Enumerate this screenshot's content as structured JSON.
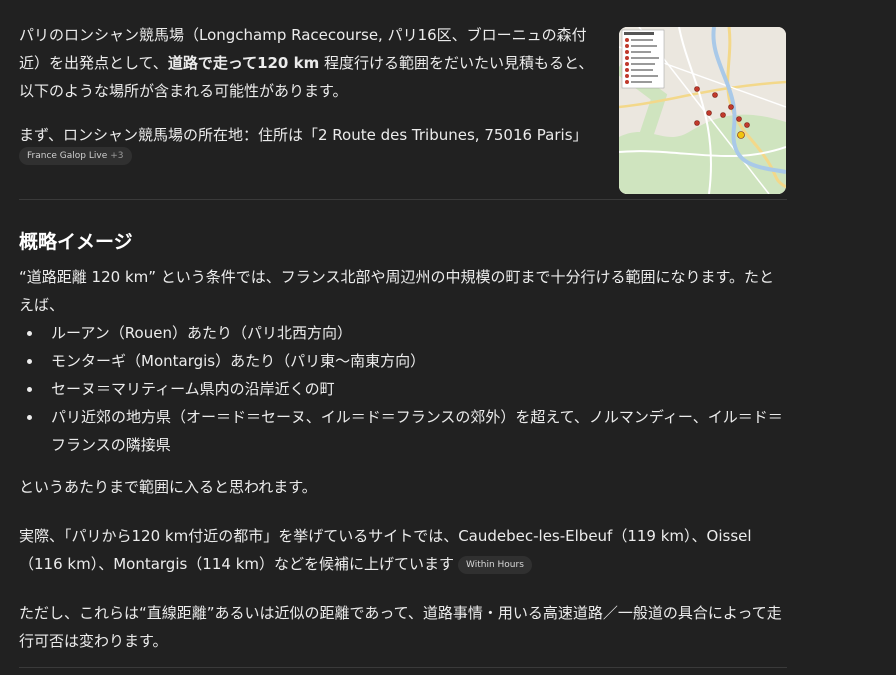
{
  "intro": {
    "p1_part1": "パリのロンシャン競馬場（Longchamp Racecourse, パリ16区、ブローニュの森付近）を出発点として、",
    "p1_bold": "道路で走って120 km",
    "p1_part2": " 程度行ける範囲をだいたい見積もると、以下のような場所が含まれる可能性があります。",
    "p2": "まず、ロンシャン競馬場の所在地：住所は「2 Route des Tribunes, 75016 Paris」",
    "citation_label": "France Galop Live",
    "citation_more": "+3"
  },
  "section": {
    "heading": "概略イメージ",
    "lead": "“道路距離 120 km” という条件では、フランス北部や周辺州の中規模の町まで十分行ける範囲になります。たとえば、",
    "bullets": [
      "ルーアン（Rouen）あたり（パリ北西方向）",
      "モンターギ（Montargis）あたり（パリ東〜南東方向）",
      "セーヌ＝マリティーム県内の沿岸近くの町",
      "パリ近郊の地方県（オー＝ド＝セーヌ、イル＝ド＝フランスの郊外）を超えて、ノルマンディー、イル＝ド＝フランスの隣接県"
    ],
    "after": "というあたりまで範囲に入ると思われます。",
    "p_sites": "実際、「パリから120 km付近の都市」を挙げているサイトでは、Caudebec-les-Elbeuf（119 km）、Oissel（116 km）、Montargis（114 km）などを候補に上げています",
    "sites_badge": "Within Hours",
    "p_note": "ただし、これらは“直線距離”あるいは近似の距離であって、道路事情・用いる高速道路／一般道の具合によって走行可否は変わります。"
  },
  "colors": {
    "background": "#212121",
    "text": "#ececec",
    "badge_bg": "#303030",
    "marker": "#c0392b"
  }
}
